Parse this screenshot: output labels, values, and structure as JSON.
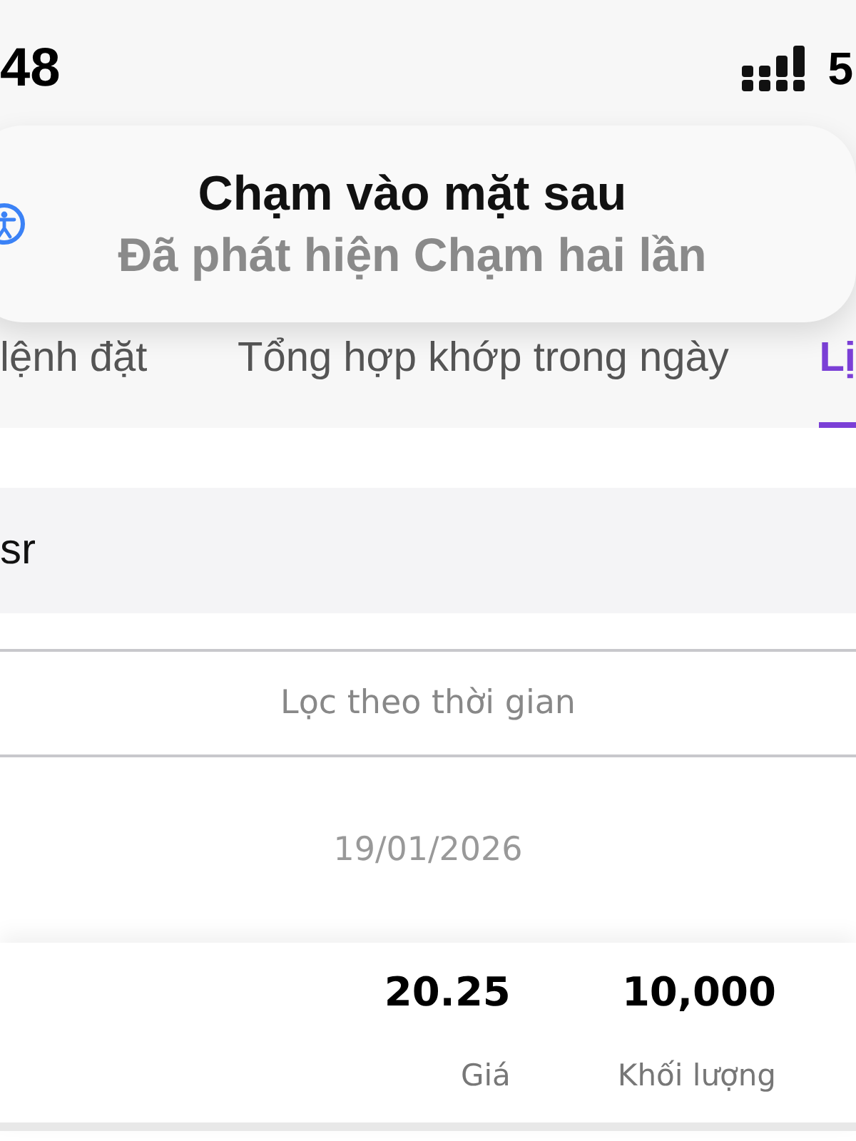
{
  "status_bar": {
    "time": "48",
    "network": "5"
  },
  "banner": {
    "title": "Chạm vào mặt sau",
    "subtitle": "Đã phát hiện Chạm hai lần"
  },
  "tabs": [
    {
      "label": "lệnh đặt",
      "selected": false
    },
    {
      "label": "Tổng hợp khớp trong ngày",
      "selected": false
    },
    {
      "label": "Lị",
      "selected": true
    }
  ],
  "search": {
    "value": "sr"
  },
  "filter": {
    "label": "Lọc theo thời gian"
  },
  "date": "19/01/2026",
  "order": {
    "price": "20.25",
    "volume": "10,000",
    "price_label": "Giá",
    "volume_label": "Khối lượng"
  }
}
